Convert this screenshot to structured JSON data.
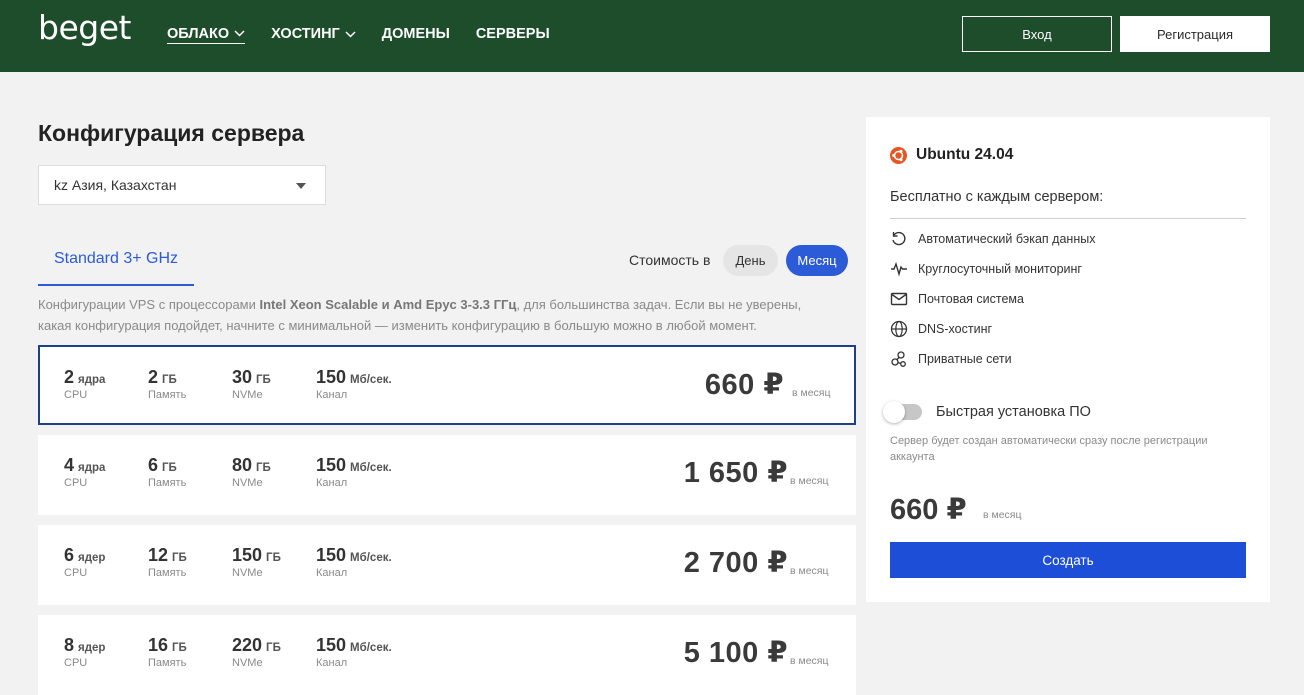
{
  "header": {
    "logo": "beget",
    "nav": [
      {
        "label": "ОБЛАКО",
        "has_dropdown": true,
        "active": true
      },
      {
        "label": "ХОСТИНГ",
        "has_dropdown": true,
        "active": false
      },
      {
        "label": "ДОМЕНЫ",
        "has_dropdown": false,
        "active": false
      },
      {
        "label": "СЕРВЕРЫ",
        "has_dropdown": false,
        "active": false
      }
    ],
    "login_label": "Вход",
    "register_label": "Регистрация"
  },
  "main": {
    "title": "Конфигурация сервера",
    "region": {
      "value": "kz Азия, Казахстан"
    },
    "tab_label": "Standard 3+ GHz",
    "cost_label": "Стоимость в",
    "period_day": "День",
    "period_month": "Месяц",
    "description": {
      "before": "Конфигурации VPS с процессорами ",
      "bold": "Intel Xeon Scalable и Amd Epyc 3-3.3 ГГц",
      "after": ", для большинства задач. Если вы не уверены, какая конфигурация подойдет, начните с минимальной — изменить конфигурацию в большую можно в любой момент."
    },
    "plans": [
      {
        "cpu": "2",
        "cpu_unit": "ядра",
        "cpu_label": "CPU",
        "ram": "2",
        "ram_unit": "ГБ",
        "ram_label": "Память",
        "disk": "30",
        "disk_unit": "ГБ",
        "disk_label": "NVMe",
        "net": "150",
        "net_unit": "Мб/сек.",
        "net_label": "Канал",
        "price": "660 ₽",
        "per": "в месяц",
        "selected": true
      },
      {
        "cpu": "4",
        "cpu_unit": "ядра",
        "cpu_label": "CPU",
        "ram": "6",
        "ram_unit": "ГБ",
        "ram_label": "Память",
        "disk": "80",
        "disk_unit": "ГБ",
        "disk_label": "NVMe",
        "net": "150",
        "net_unit": "Мб/сек.",
        "net_label": "Канал",
        "price": "1 650 ₽",
        "per": "в месяц",
        "selected": false
      },
      {
        "cpu": "6",
        "cpu_unit": "ядер",
        "cpu_label": "CPU",
        "ram": "12",
        "ram_unit": "ГБ",
        "ram_label": "Память",
        "disk": "150",
        "disk_unit": "ГБ",
        "disk_label": "NVMe",
        "net": "150",
        "net_unit": "Мб/сек.",
        "net_label": "Канал",
        "price": "2 700 ₽",
        "per": "в месяц",
        "selected": false
      },
      {
        "cpu": "8",
        "cpu_unit": "ядер",
        "cpu_label": "CPU",
        "ram": "16",
        "ram_unit": "ГБ",
        "ram_label": "Память",
        "disk": "220",
        "disk_unit": "ГБ",
        "disk_label": "NVMe",
        "net": "150",
        "net_unit": "Мб/сек.",
        "net_label": "Канал",
        "price": "5 100 ₽",
        "per": "в месяц",
        "selected": false
      }
    ]
  },
  "panel": {
    "os_name": "Ubuntu 24.04",
    "free_title": "Бесплатно с каждым сервером:",
    "features": [
      {
        "icon": "backup-icon",
        "label": "Автоматический бэкап данных"
      },
      {
        "icon": "monitoring-icon",
        "label": "Круглосуточный мониторинг"
      },
      {
        "icon": "mail-icon",
        "label": "Почтовая система"
      },
      {
        "icon": "globe-icon",
        "label": "DNS-хостинг"
      },
      {
        "icon": "network-icon",
        "label": "Приватные сети"
      }
    ],
    "toggle_label": "Быстрая установка ПО",
    "toggle_on": false,
    "toggle_note": "Сервер будет создан автоматически сразу после регистрации аккаунта",
    "price": "660 ₽",
    "per": "в месяц",
    "create_label": "Создать"
  },
  "colors": {
    "header_bg": "#1e4d2b",
    "accent_blue": "#2c5bd8",
    "create_button": "#1d4ed8",
    "ubuntu_orange": "#e95420"
  }
}
